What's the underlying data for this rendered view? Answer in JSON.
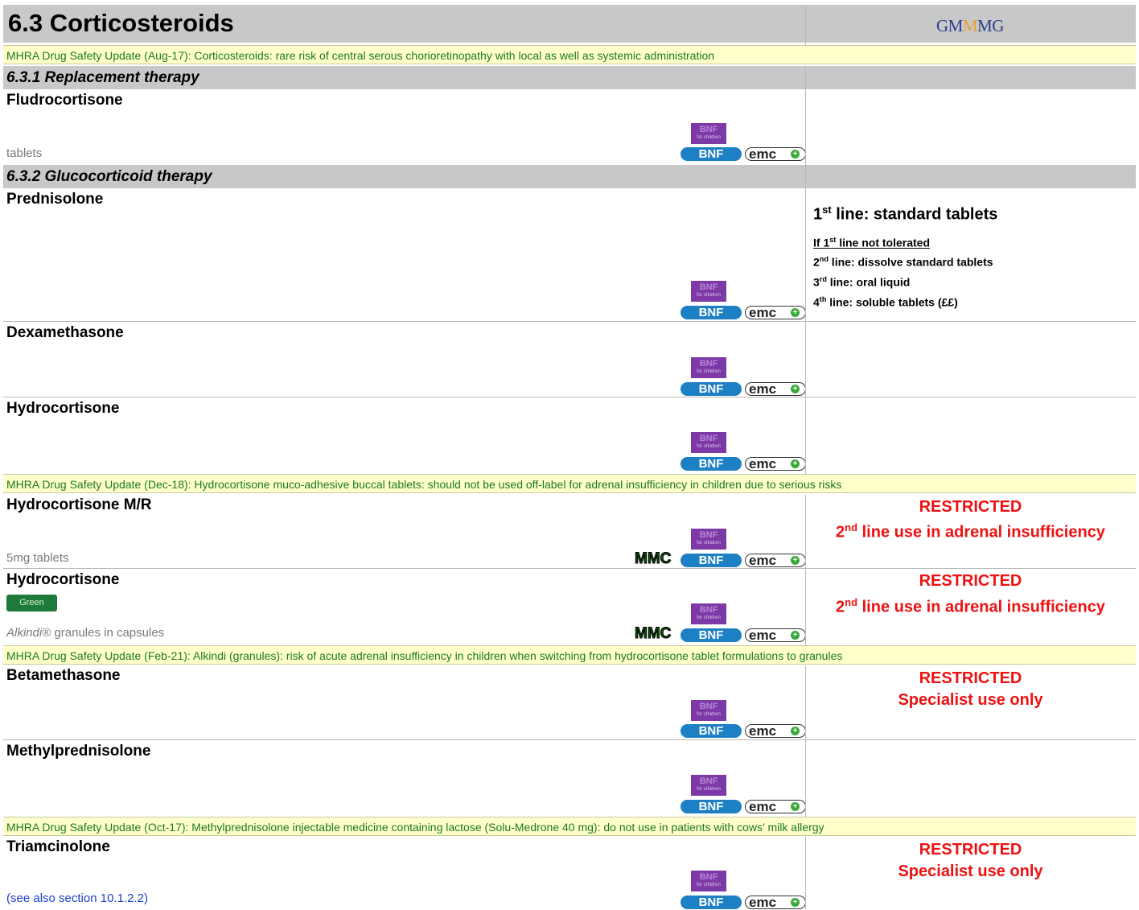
{
  "header": {
    "title": "6.3 Corticosteroids",
    "logo_text_a": "GM",
    "logo_text_v": "M",
    "logo_text_b": "MG"
  },
  "mhra": {
    "aug17": "MHRA Drug Safety Update (Aug-17): Corticosteroids: rare risk of central serous chorioretinopathy with local as well as systemic administration",
    "dec18": "MHRA Drug Safety Update (Dec-18): Hydrocortisone muco-adhesive buccal tablets: should not be used off-label for adrenal insufficiency in children due to serious risks",
    "feb21": "MHRA Drug Safety Update (Feb-21): Alkindi (granules): risk of acute adrenal insufficiency in children when switching from hydrocortisone tablet formulations to granules",
    "oct17": "MHRA Drug Safety Update (Oct-17): Methylprednisolone injectable medicine containing lactose (Solu-Medrone 40 mg): do not use in patients with cows’ milk allergy"
  },
  "sections": {
    "s631": "6.3.1 Replacement therapy",
    "s632": "6.3.2 Glucocorticoid therapy"
  },
  "links": {
    "bnfc_top": "BNF",
    "bnfc_bottom": "for children",
    "bnf": "BNF",
    "emc": "emc",
    "emc_plus": "+",
    "mmc": "MMC"
  },
  "drugs": {
    "fludrocortisone": {
      "name": "Fludrocortisone",
      "form": "tablets"
    },
    "prednisolone": {
      "name": "Prednisolone",
      "line1_ord": "1",
      "line1_sup": "st",
      "line1_label": " line:",
      "line1_text": " standard tablets",
      "intolerance_a": "If 1",
      "intolerance_sup": "st",
      "intolerance_b": " line not tolerated",
      "line2_ord": "2",
      "line2_sup": "nd",
      "line2_label": " line:",
      "line2_text": " dissolve standard tablets",
      "line3_ord": "3",
      "line3_sup": "rd",
      "line3_label": " line:",
      "line3_text": " oral liquid",
      "line4_ord": "4",
      "line4_sup": "th",
      "line4_label": " line:",
      "line4_text": " soluble tablets (££)"
    },
    "dexamethasone": {
      "name": "Dexamethasone"
    },
    "hydrocortisone": {
      "name": "Hydrocortisone"
    },
    "hydrocortisone_mr": {
      "name": "Hydrocortisone M/R",
      "form": "5mg tablets",
      "restricted": "RESTRICTED",
      "note_ord": "2",
      "note_sup": "nd",
      "note_text": " line use in adrenal insufficiency"
    },
    "hydrocortisone_granules": {
      "name": "Hydrocortisone",
      "badge": "Green",
      "form_brand": "Alkindi®",
      "form_rest": " granules in capsules",
      "restricted": "RESTRICTED",
      "note_ord": "2",
      "note_sup": "nd",
      "note_text": " line use in adrenal insufficiency"
    },
    "betamethasone": {
      "name": "Betamethasone",
      "restricted": "RESTRICTED",
      "note": "Specialist use only"
    },
    "methylprednisolone": {
      "name": "Methylprednisolone"
    },
    "triamcinolone": {
      "name": "Triamcinolone",
      "form": "(see also section 10.1.2.2)",
      "restricted": "RESTRICTED",
      "note": "Specialist use only"
    }
  }
}
